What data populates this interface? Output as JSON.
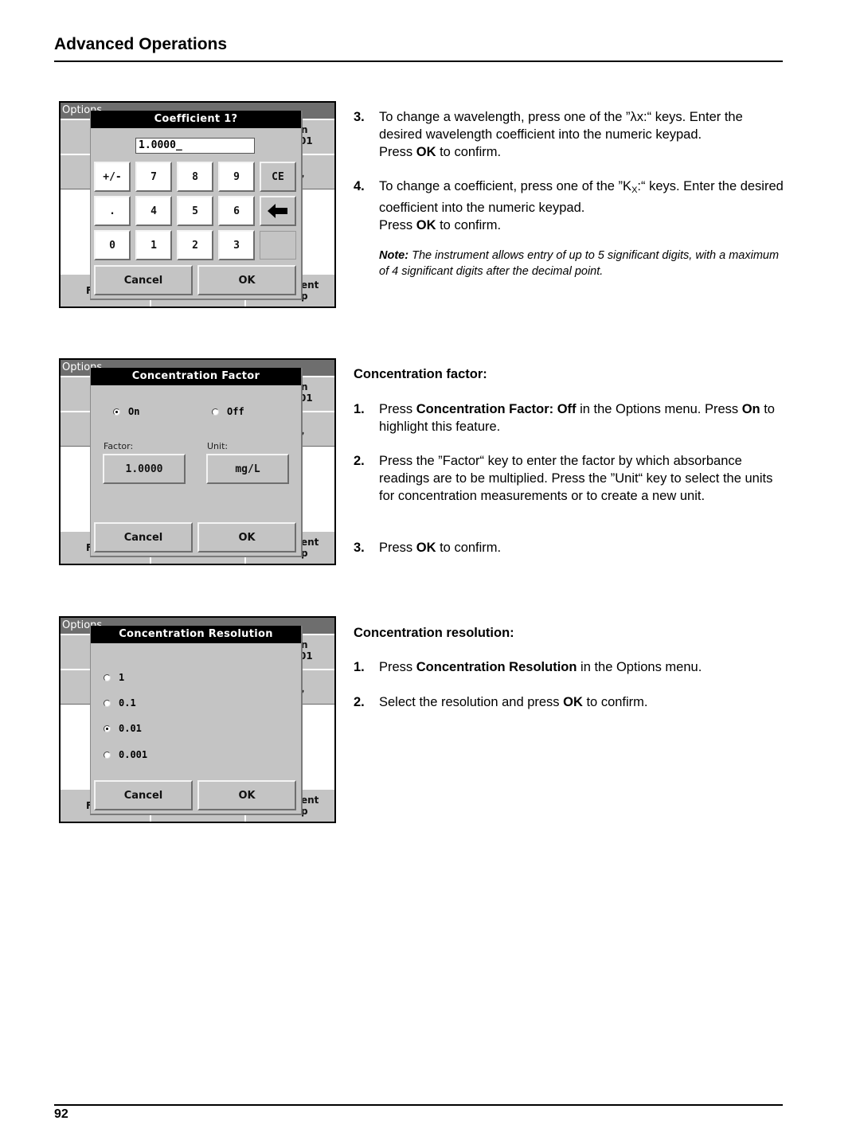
{
  "page": {
    "section_title": "Advanced Operations",
    "page_number": "92"
  },
  "screens": {
    "coefficient": {
      "background_bar": "Options",
      "title": "Coefficient  1?",
      "value": "1.0000_",
      "keypad": [
        [
          "+/-",
          "7",
          "8",
          "9",
          "CE"
        ],
        [
          ".",
          "4",
          "5",
          "6",
          "backspace"
        ],
        [
          "0",
          "1",
          "2",
          "3",
          ""
        ]
      ],
      "cancel_label": "Cancel",
      "ok_label": "OK",
      "bg_fragments": [
        "n",
        "01",
        "ent",
        "p",
        "F"
      ]
    },
    "concentration_factor": {
      "background_bar": "Options",
      "title": "Concentration Factor",
      "radio_on_label": "On",
      "radio_off_label": "Off",
      "selected": "On",
      "factor_label": "Factor:",
      "factor_value": "1.0000",
      "unit_label": "Unit:",
      "unit_value": "mg/L",
      "cancel_label": "Cancel",
      "ok_label": "OK"
    },
    "concentration_resolution": {
      "background_bar": "Options",
      "title": "Concentration Resolution",
      "options": [
        "1",
        "0.1",
        "0.01",
        "0.001"
      ],
      "selected": "0.01",
      "cancel_label": "Cancel",
      "ok_label": "OK"
    }
  },
  "text": {
    "coefficient_steps": [
      {
        "num": "3.",
        "pre": "To change a wavelength, press one of the ”λx:“ keys. Enter the desired wavelength coefficient into the numeric keypad.",
        "press": "Press ",
        "bold": "OK",
        "post": " to confirm."
      },
      {
        "num": "4.",
        "pre_a": "To change a coefficient, press one of the ”K",
        "sub": "X",
        "pre_b": ":“ keys. Enter the desired coefficient into the numeric keypad.",
        "press": "Press ",
        "bold": "OK",
        "post": " to confirm."
      }
    ],
    "note": {
      "label": "Note:",
      "body": " The instrument allows entry of up to 5 significant digits, with a maximum of 4 significant digits after the decimal point."
    },
    "concentration_factor": {
      "heading": "Concentration factor:",
      "steps": [
        {
          "num": "1.",
          "a": "Press ",
          "b": "Concentration Factor: Off",
          "c": " in the Options menu. Press ",
          "d": "On",
          "e": " to highlight this feature."
        },
        {
          "num": "2.",
          "a": "Press the ”Factor“ key to enter the factor by which absorbance readings are to be multiplied. Press the ”Unit“ key to select the units for concentration measurements or to create a new unit."
        },
        {
          "num": "3.",
          "a": "Press ",
          "b": "OK",
          "c": " to confirm."
        }
      ]
    },
    "concentration_resolution": {
      "heading": "Concentration resolution:",
      "steps": [
        {
          "num": "1.",
          "a": "Press ",
          "b": "Concentration Resolution",
          "c": " in the Options menu."
        },
        {
          "num": "2.",
          "a": "Select the resolution and press ",
          "b": "OK",
          "c": " to confirm."
        }
      ]
    }
  }
}
